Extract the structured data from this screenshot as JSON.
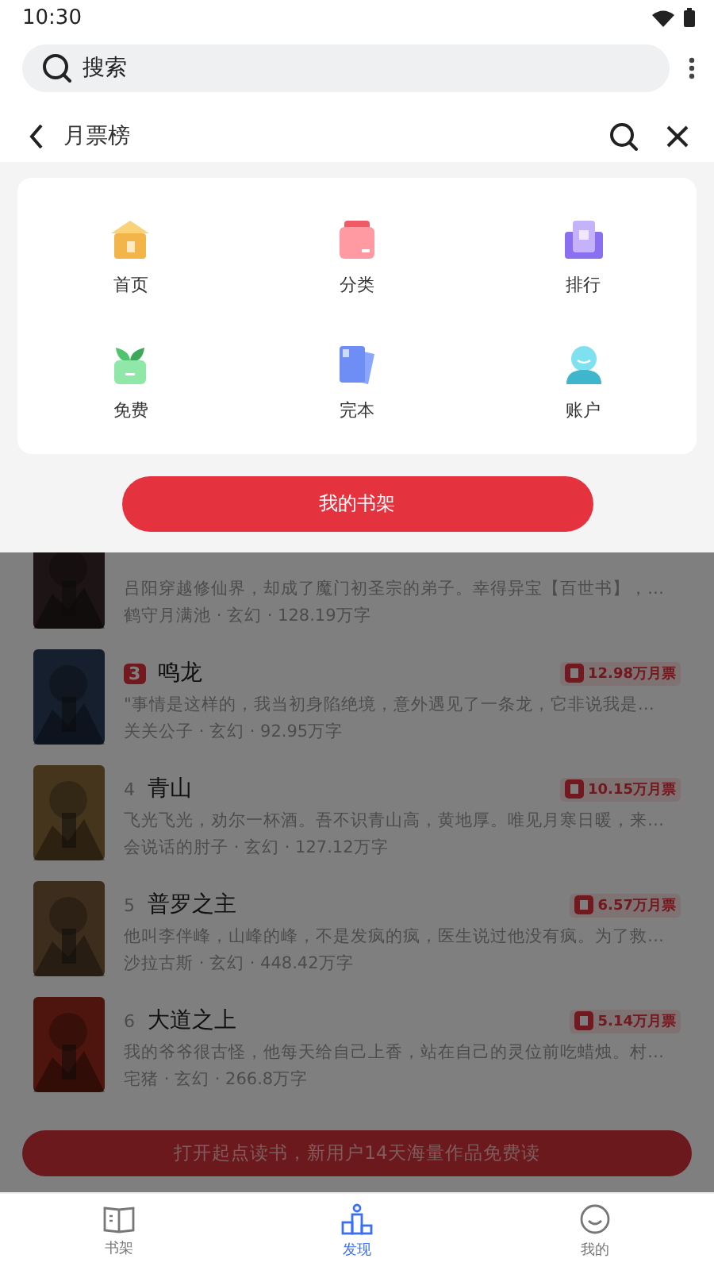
{
  "status_bar": {
    "time": "10:30"
  },
  "search": {
    "placeholder": "搜索"
  },
  "header": {
    "title": "月票榜"
  },
  "menu": {
    "items": [
      {
        "label": "首页",
        "kind": "home"
      },
      {
        "label": "分类",
        "kind": "category"
      },
      {
        "label": "排行",
        "kind": "rank"
      },
      {
        "label": "免费",
        "kind": "free"
      },
      {
        "label": "完本",
        "kind": "finished"
      },
      {
        "label": "账户",
        "kind": "account"
      }
    ],
    "button": "我的书架"
  },
  "books": [
    {
      "description": "吕阳穿越修仙界，却成了魔门初圣宗的弟子。幸得异宝【百世书】，…",
      "meta": "鹤守月满池 · 玄幻 · 128.19万字"
    },
    {
      "rank": "3",
      "top": true,
      "title": "鸣龙",
      "votes": "12.98万月票",
      "description": "\"事情是这样的，我当初身陷绝境，意外遇见了一条龙，它非说我是…",
      "meta": "关关公子 · 玄幻 · 92.95万字"
    },
    {
      "rank": "4",
      "top": false,
      "title": "青山",
      "votes": "10.15万月票",
      "description": "飞光飞光，劝尔一杯酒。吾不识青山高，黄地厚。唯见月寒日暖，来…",
      "meta": "会说话的肘子 · 玄幻 · 127.12万字"
    },
    {
      "rank": "5",
      "top": false,
      "title": "普罗之主",
      "votes": "6.57万月票",
      "description": "他叫李伴峰，山峰的峰，不是发疯的疯，医生说过他没有疯。为了救…",
      "meta": "沙拉古斯 · 玄幻 · 448.42万字"
    },
    {
      "rank": "6",
      "top": false,
      "title": "大道之上",
      "votes": "5.14万月票",
      "description": "我的爷爷很古怪，他每天给自己上香，站在自己的灵位前吃蜡烛。村…",
      "meta": "宅猪 · 玄幻 · 266.8万字"
    }
  ],
  "banner": "打开起点读书，新用户14天海量作品免费读",
  "nav": [
    {
      "label": "书架",
      "kind": "shelf",
      "selected": false
    },
    {
      "label": "发现",
      "kind": "discover",
      "selected": true
    },
    {
      "label": "我的",
      "kind": "me",
      "selected": false
    }
  ]
}
